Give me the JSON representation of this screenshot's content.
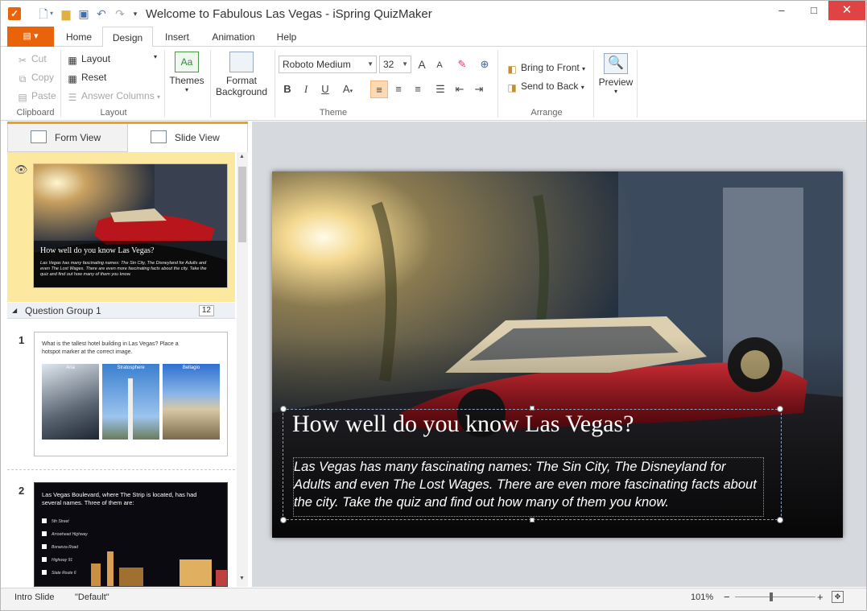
{
  "window": {
    "title": "Welcome to Fabulous Las Vegas - iSpring QuizMaker",
    "app_logo": "checkmark-logo-icon",
    "minimize": "–",
    "maximize": "□",
    "close": "✕"
  },
  "tabs": {
    "file_icon": "menu-icon",
    "items": [
      "Home",
      "Design",
      "Insert",
      "Animation",
      "Help"
    ],
    "active": "Design"
  },
  "ribbon": {
    "clipboard": {
      "label": "Clipboard",
      "cut": "Cut",
      "copy": "Copy",
      "paste": "Paste"
    },
    "layout": {
      "label": "Layout",
      "layout_btn": "Layout",
      "reset": "Reset",
      "answer_columns": "Answer Columns"
    },
    "themes": {
      "themes": "Themes",
      "format_background_1": "Format",
      "format_background_2": "Background"
    },
    "theme": {
      "label": "Theme",
      "font_name": "Roboto Medium",
      "font_size": "32",
      "bold": "B",
      "italic": "I",
      "underline": "U",
      "font_color": "A",
      "grow": "A",
      "shrink": "A"
    },
    "arrange": {
      "label": "Arrange",
      "bring_to_front": "Bring to Front",
      "send_to_back": "Send to Back"
    },
    "preview": {
      "label": "Preview"
    }
  },
  "left_panel": {
    "form_view": "Form View",
    "slide_view": "Slide View",
    "intro_slide": {
      "title": "How well do you know Las Vegas?",
      "body": "Las Vegas has many fascinating names: The Sin City, The Disneyland for Adults and even The Lost Wages. There are even more fascinating facts about the city. Take the quiz and find out how many of them you know."
    },
    "group": {
      "name": "Question Group 1",
      "count": "12"
    },
    "slide1": {
      "number": "1",
      "question": "What is the tallest hotel building in Las Vegas? Place a hotspot marker at the correct image.",
      "images": [
        "Aria",
        "Stratosphere",
        "Bellagio"
      ]
    },
    "slide2": {
      "number": "2",
      "question": "Las Vegas Boulevard, where The Strip is located, has had several names. Three of them are:",
      "options": [
        "5th Street",
        "Arrowhead Highway",
        "Bonanza Road",
        "Highway 91",
        "State Route 6"
      ]
    }
  },
  "slide": {
    "title": "How well do you know Las Vegas?",
    "body": "Las Vegas has many fascinating names: The Sin City, The Disneyland for Adults and even The Lost Wages. There are even more fascinating facts about the city. Take the quiz and find out how many of them you know."
  },
  "status": {
    "slide_name": "Intro Slide",
    "layout_name": "\"Default\"",
    "zoom": "101%",
    "zoom_minus": "−",
    "zoom_plus": "+"
  }
}
